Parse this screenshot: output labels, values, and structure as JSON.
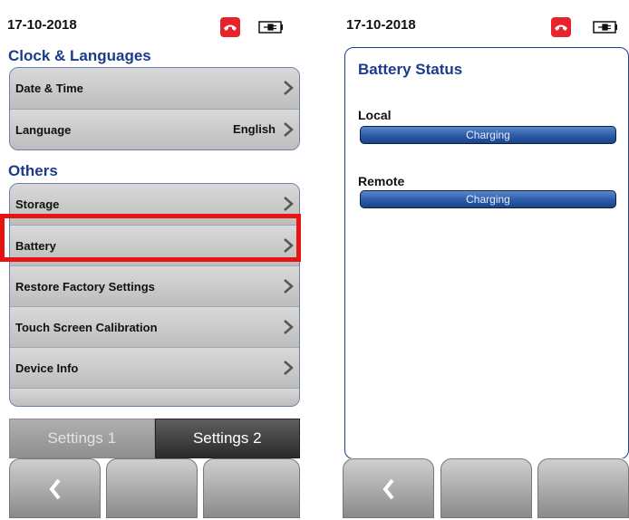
{
  "left": {
    "date": "17-10-2018",
    "sections": {
      "clock": "Clock & Languages",
      "others": "Others"
    },
    "clock_items": [
      {
        "label": "Date & Time",
        "value": ""
      },
      {
        "label": "Language",
        "value": "English"
      }
    ],
    "other_items": [
      {
        "label": "Storage"
      },
      {
        "label": "Battery"
      },
      {
        "label": "Restore Factory Settings"
      },
      {
        "label": "Touch Screen Calibration"
      },
      {
        "label": "Device Info"
      }
    ],
    "tabs": {
      "tab1": "Settings 1",
      "tab2": "Settings 2",
      "active": "Settings 2"
    }
  },
  "right": {
    "date": "17-10-2018",
    "title": "Battery Status",
    "local": {
      "label": "Local",
      "status": "Charging"
    },
    "remote": {
      "label": "Remote",
      "status": "Charging"
    }
  },
  "icons": {
    "phone": "phone-hangup-icon",
    "battery": "battery-plug-icon",
    "chevron": "chevron-right-icon",
    "back": "back-arrow-icon"
  },
  "colors": {
    "accent": "#1a3c8c",
    "phone_red": "#e8232b",
    "highlight": "#e81414",
    "bar_blue": "#2a5aa8"
  }
}
